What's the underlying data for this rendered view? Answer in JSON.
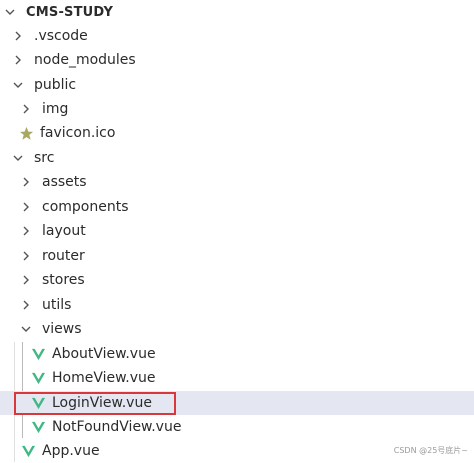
{
  "explorer": {
    "root": {
      "label": "CMS-STUDY"
    },
    "items": [
      {
        "label": ".vscode"
      },
      {
        "label": "node_modules"
      },
      {
        "label": "public"
      },
      {
        "label": "img"
      },
      {
        "label": "favicon.ico"
      },
      {
        "label": "src"
      },
      {
        "label": "assets"
      },
      {
        "label": "components"
      },
      {
        "label": "layout"
      },
      {
        "label": "router"
      },
      {
        "label": "stores"
      },
      {
        "label": "utils"
      },
      {
        "label": "views"
      },
      {
        "label": "AboutView.vue"
      },
      {
        "label": "HomeView.vue"
      },
      {
        "label": "LoginView.vue"
      },
      {
        "label": "NotFoundView.vue"
      },
      {
        "label": "App.vue"
      }
    ]
  },
  "colors": {
    "selected_row": "#e4e6f1",
    "highlight_border": "#d9383a",
    "vue_icon": "#41b883",
    "favicon_star": "#a8a860"
  },
  "watermark": "CSDN @25号底片~"
}
